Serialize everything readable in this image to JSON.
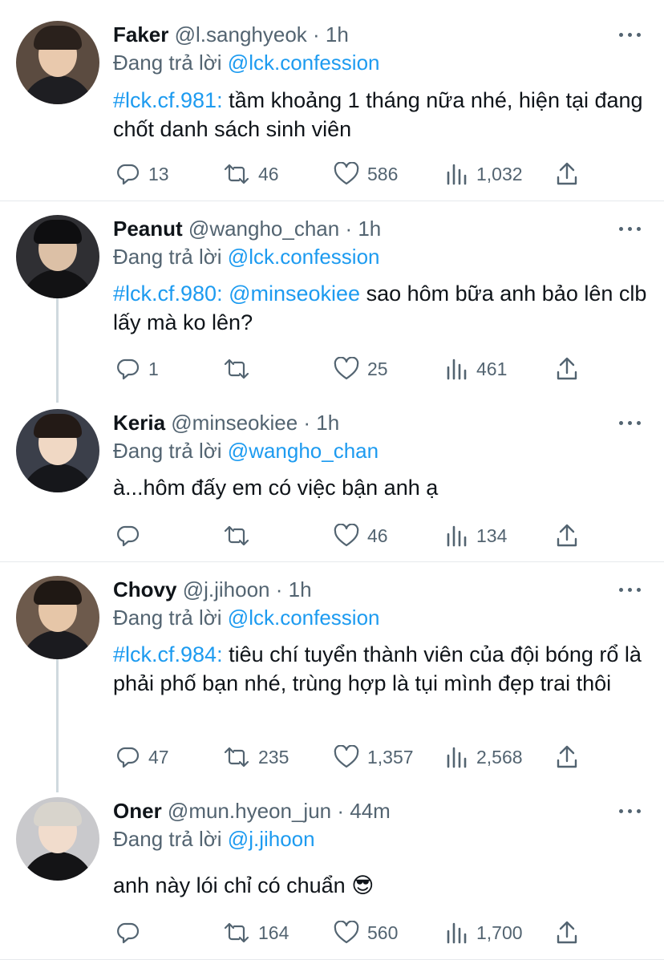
{
  "tweets": [
    {
      "name": "Faker",
      "handle": "@l.sanghyeok",
      "time": "· 1h",
      "reply_prefix": "Đang trả lời",
      "reply_to": "@lck.confession",
      "tag": "#lck.cf.981:",
      "text": " tầm khoảng 1 tháng nữa nhé, hiện tại đang chốt danh sách sinh viên",
      "replies": "13",
      "retweets": "46",
      "likes": "586",
      "views": "1,032"
    },
    {
      "name": "Peanut",
      "handle": "@wangho_chan",
      "time": "· 1h",
      "reply_prefix": "Đang trả lời",
      "reply_to": "@lck.confession",
      "tag": "#lck.cf.980:",
      "mention": " @minseokiee",
      "text": " sao hôm bữa anh bảo lên clb lấy mà ko lên?",
      "replies": "1",
      "retweets": "",
      "likes": "25",
      "views": "461"
    },
    {
      "name": "Keria",
      "handle": "@minseokiee",
      "time": "· 1h",
      "reply_prefix": "Đang trả lời",
      "reply_to": "@wangho_chan",
      "text": "à...hôm đấy em có việc bận anh ạ",
      "replies": "",
      "retweets": "",
      "likes": "46",
      "views": "134"
    },
    {
      "name": "Chovy",
      "handle": "@j.jihoon",
      "time": "· 1h",
      "reply_prefix": "Đang trả lời",
      "reply_to": "@lck.confession",
      "tag": "#lck.cf.984:",
      "text": " tiêu chí tuyển thành viên của đội bóng rổ là phải phố bạn nhé, trùng hợp là tụi mình đẹp trai thôi",
      "replies": "47",
      "retweets": "235",
      "likes": "1,357",
      "views": "2,568"
    },
    {
      "name": "Oner",
      "handle": "@mun.hyeon_jun",
      "time": "· 44m",
      "reply_prefix": "Đang trả lời",
      "reply_to": "@j.jihoon",
      "text": "anh này lói chỉ có chuẩn 😎",
      "replies": "",
      "retweets": "164",
      "likes": "560",
      "views": "1,700"
    }
  ],
  "icons": {
    "reply": "reply-icon",
    "retweet": "retweet-icon",
    "like": "heart-icon",
    "views": "views-icon",
    "share": "share-icon",
    "more": "more-icon"
  },
  "colors": {
    "accent": "#1d9bf0",
    "secondary_text": "#536471",
    "divider": "#e6e9ec",
    "thread_line": "#cfd9de"
  }
}
